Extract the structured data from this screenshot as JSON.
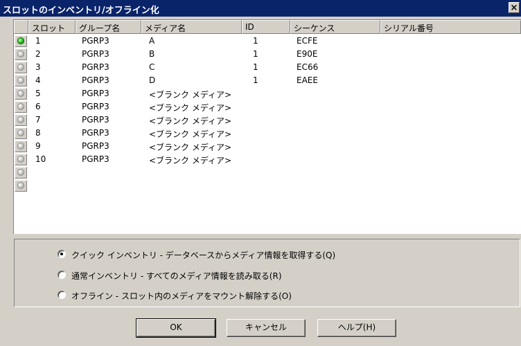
{
  "window": {
    "title": "スロットのインベントリ/オフライン化",
    "close_label": "×"
  },
  "table": {
    "columns": [
      "スロット",
      "グループ名",
      "メディア名",
      "ID",
      "シーケンス",
      "シリアル番号"
    ],
    "rows": [
      {
        "status": "online",
        "slot": "1",
        "group": "PGRP3",
        "media": "A",
        "id": "1",
        "seq": "ECFE",
        "serial": ""
      },
      {
        "status": "offline",
        "slot": "2",
        "group": "PGRP3",
        "media": "B",
        "id": "1",
        "seq": "E90E",
        "serial": ""
      },
      {
        "status": "offline",
        "slot": "3",
        "group": "PGRP3",
        "media": "C",
        "id": "1",
        "seq": "EC66",
        "serial": ""
      },
      {
        "status": "offline",
        "slot": "4",
        "group": "PGRP3",
        "media": "D",
        "id": "1",
        "seq": "EAEE",
        "serial": ""
      },
      {
        "status": "offline",
        "slot": "5",
        "group": "PGRP3",
        "media": "<ブランク メディア>",
        "id": "",
        "seq": "",
        "serial": ""
      },
      {
        "status": "offline",
        "slot": "6",
        "group": "PGRP3",
        "media": "<ブランク メディア>",
        "id": "",
        "seq": "",
        "serial": ""
      },
      {
        "status": "offline",
        "slot": "7",
        "group": "PGRP3",
        "media": "<ブランク メディア>",
        "id": "",
        "seq": "",
        "serial": ""
      },
      {
        "status": "offline",
        "slot": "8",
        "group": "PGRP3",
        "media": "<ブランク メディア>",
        "id": "",
        "seq": "",
        "serial": ""
      },
      {
        "status": "offline",
        "slot": "9",
        "group": "PGRP3",
        "media": "<ブランク メディア>",
        "id": "",
        "seq": "",
        "serial": ""
      },
      {
        "status": "offline",
        "slot": "10",
        "group": "PGRP3",
        "media": "<ブランク メディア>",
        "id": "",
        "seq": "",
        "serial": ""
      },
      {
        "status": "offline",
        "slot": "",
        "group": "",
        "media": "",
        "id": "",
        "seq": "",
        "serial": ""
      },
      {
        "status": "offline",
        "slot": "",
        "group": "",
        "media": "",
        "id": "",
        "seq": "",
        "serial": ""
      }
    ]
  },
  "options": [
    {
      "label": "クイック インベントリ - データベースからメディア情報を取得する(Q)",
      "checked": true
    },
    {
      "label": "通常インベントリ - すべてのメディア情報を読み取る(R)",
      "checked": false
    },
    {
      "label": "オフライン - スロット内のメディアをマウント解除する(O)",
      "checked": false
    }
  ],
  "buttons": {
    "ok": "OK",
    "cancel": "キャンセル",
    "help": "ヘルプ(H)"
  },
  "colors": {
    "titlebar": "#0a246a",
    "face": "#d4d0c8",
    "online_led": "#22c11a",
    "offline_led": "#c4c4c4"
  }
}
